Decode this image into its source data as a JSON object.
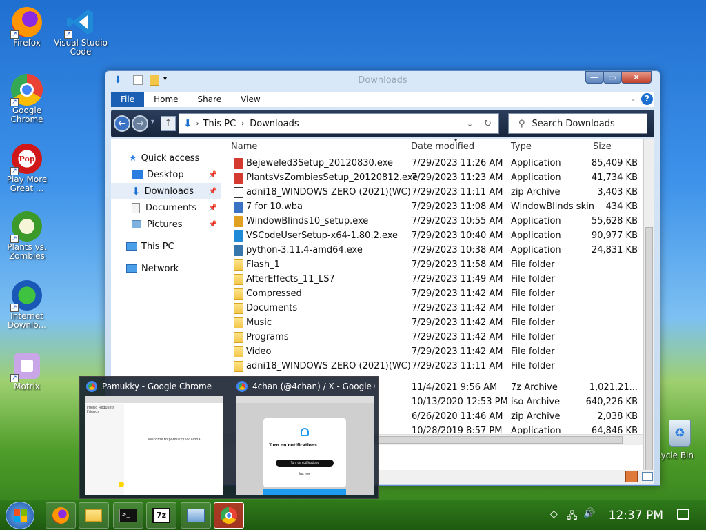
{
  "desktop": {
    "icons": [
      {
        "label": "Firefox"
      },
      {
        "label": "Visual Studio Code"
      },
      {
        "label": "Google Chrome"
      },
      {
        "label": "Play More Great ..."
      },
      {
        "label": "Plants vs. Zombies"
      },
      {
        "label": "Internet Downlo..."
      },
      {
        "label": "Motrix"
      },
      {
        "label": "cycle Bin"
      }
    ]
  },
  "window": {
    "title": "Downloads",
    "ribbon_tabs": [
      "File",
      "Home",
      "Share",
      "View"
    ],
    "breadcrumb": [
      "This PC",
      "Downloads"
    ],
    "search_placeholder": "Search Downloads",
    "nav": {
      "quick_access": "Quick access",
      "items": [
        "Desktop",
        "Downloads",
        "Documents",
        "Pictures"
      ],
      "this_pc": "This PC",
      "network": "Network"
    },
    "columns": [
      "Name",
      "Date modified",
      "Type",
      "Size"
    ],
    "files": [
      {
        "name": "Bejeweled3Setup_20120830.exe",
        "date": "7/29/2023 11:26 AM",
        "type": "Application",
        "size": "85,409 KB"
      },
      {
        "name": "PlantsVsZombiesSetup_20120812.exe",
        "date": "7/29/2023 11:23 AM",
        "type": "Application",
        "size": "41,734 KB"
      },
      {
        "name": "adni18_WINDOWS ZERO (2021)(WC)",
        "date": "7/29/2023 11:11 AM",
        "type": "zip Archive",
        "size": "3,403 KB"
      },
      {
        "name": "7 for 10.wba",
        "date": "7/29/2023 11:08 AM",
        "type": "WindowBlinds skin",
        "size": "434 KB"
      },
      {
        "name": "WindowBlinds10_setup.exe",
        "date": "7/29/2023 10:55 AM",
        "type": "Application",
        "size": "55,628 KB"
      },
      {
        "name": "VSCodeUserSetup-x64-1.80.2.exe",
        "date": "7/29/2023 10:40 AM",
        "type": "Application",
        "size": "90,977 KB"
      },
      {
        "name": "python-3.11.4-amd64.exe",
        "date": "7/29/2023 10:38 AM",
        "type": "Application",
        "size": "24,831 KB"
      },
      {
        "name": "Flash_1",
        "date": "7/29/2023 11:58 AM",
        "type": "File folder",
        "size": ""
      },
      {
        "name": "AfterEffects_11_LS7",
        "date": "7/29/2023 11:49 AM",
        "type": "File folder",
        "size": ""
      },
      {
        "name": "Compressed",
        "date": "7/29/2023 11:42 AM",
        "type": "File folder",
        "size": ""
      },
      {
        "name": "Documents",
        "date": "7/29/2023 11:42 AM",
        "type": "File folder",
        "size": ""
      },
      {
        "name": "Music",
        "date": "7/29/2023 11:42 AM",
        "type": "File folder",
        "size": ""
      },
      {
        "name": "Programs",
        "date": "7/29/2023 11:42 AM",
        "type": "File folder",
        "size": ""
      },
      {
        "name": "Video",
        "date": "7/29/2023 11:42 AM",
        "type": "File folder",
        "size": ""
      },
      {
        "name": "adni18_WINDOWS ZERO (2021)(WC)",
        "date": "7/29/2023 11:11 AM",
        "type": "File folder",
        "size": ""
      },
      {
        "name": "",
        "date": "11/4/2021 9:56 AM",
        "type": "7z Archive",
        "size": "1,021,21..."
      },
      {
        "name": "",
        "date": "10/13/2020 12:53 PM",
        "type": "iso Archive",
        "size": "640,226 KB"
      },
      {
        "name": "",
        "date": "6/26/2020 11:46 AM",
        "type": "zip Archive",
        "size": "2,038 KB"
      },
      {
        "name": "",
        "date": "10/28/2019 8:57 PM",
        "type": "Application",
        "size": "64,846 KB"
      }
    ]
  },
  "previews": [
    {
      "title": "Pamukky - Google Chrome",
      "body": "Welcome to pamukky v2 alpha!",
      "side": "Friend Requests\nFriends"
    },
    {
      "title": "4chan (@4chan) / X - Google C...",
      "heading": "Turn on notifications",
      "button": "Turn on notifications",
      "skip": "Not now"
    }
  ],
  "taskbar": {
    "clock": "12:37 PM"
  }
}
